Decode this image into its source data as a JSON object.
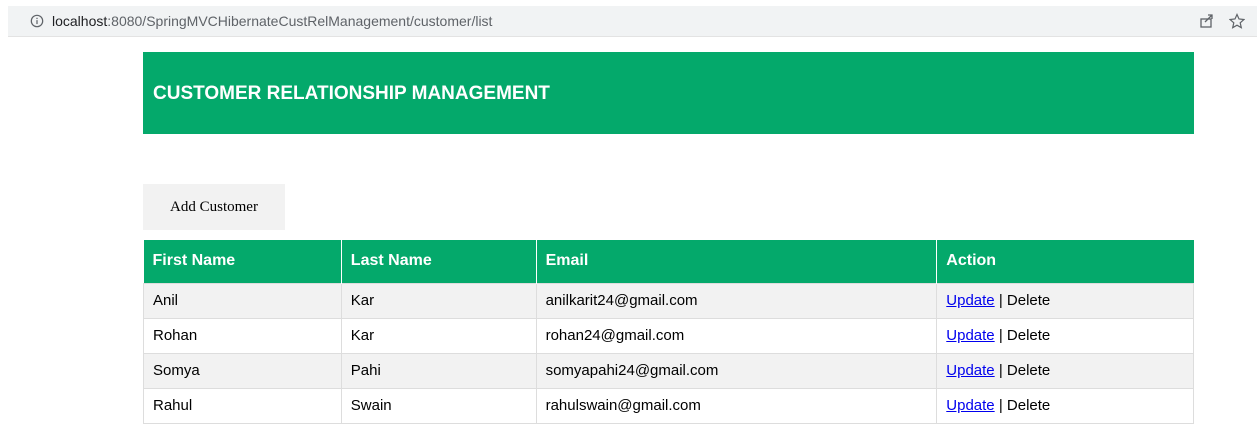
{
  "browser": {
    "url_host": "localhost",
    "url_path": ":8080/SpringMVCHibernateCustRelManagement/customer/list"
  },
  "header": {
    "title": "CUSTOMER RELATIONSHIP MANAGEMENT"
  },
  "toolbar": {
    "add_label": "Add Customer"
  },
  "table": {
    "columns": [
      "First Name",
      "Last Name",
      "Email",
      "Action"
    ],
    "rows": [
      {
        "first": "Anil",
        "last": "Kar",
        "email": "anilkarit24@gmail.com",
        "update": "Update",
        "sep": " | ",
        "delete": "Delete"
      },
      {
        "first": "Rohan",
        "last": "Kar",
        "email": "rohan24@gmail.com",
        "update": "Update",
        "sep": " | ",
        "delete": "Delete"
      },
      {
        "first": "Somya",
        "last": "Pahi",
        "email": "somyapahi24@gmail.com",
        "update": "Update",
        "sep": " | ",
        "delete": "Delete"
      },
      {
        "first": "Rahul",
        "last": "Swain",
        "email": "rahulswain@gmail.com",
        "update": "Update",
        "sep": " | ",
        "delete": "Delete"
      }
    ]
  },
  "colors": {
    "brand": "#04a96b",
    "row_alt": "#f2f2f2",
    "link": "#0000ee"
  },
  "icons": {
    "url_info": "info-icon",
    "share": "share-icon",
    "bookmark": "star-icon"
  }
}
